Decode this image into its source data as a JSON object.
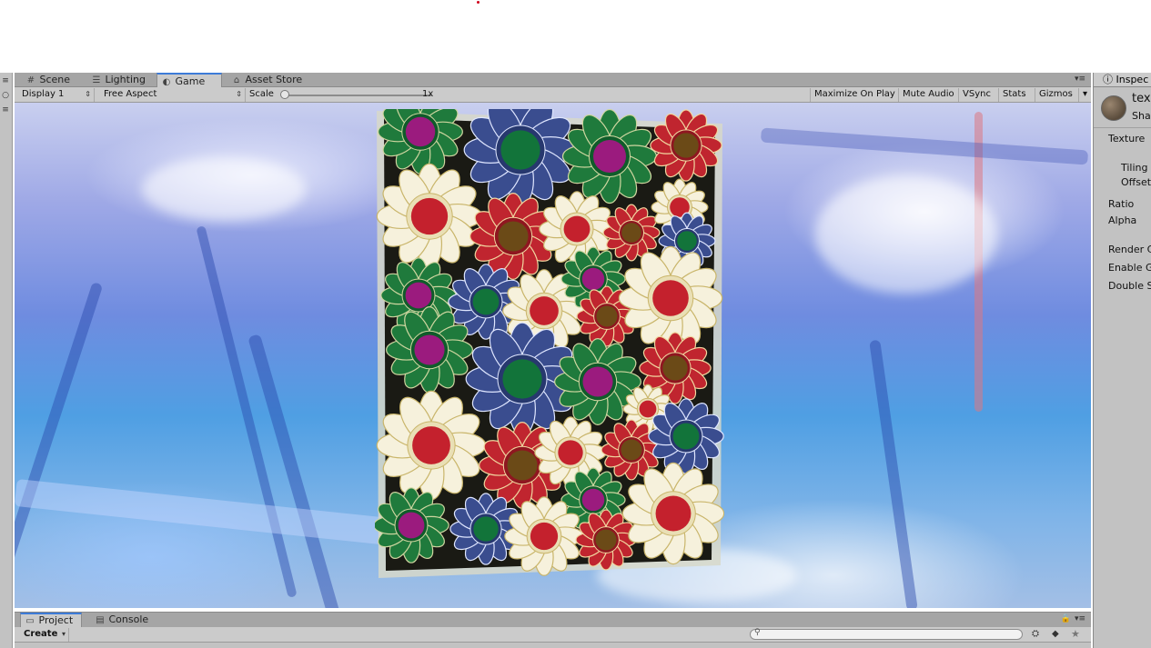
{
  "scene_tabs": [
    {
      "label": "Scene",
      "icon": "grid-icon"
    },
    {
      "label": "Lighting",
      "icon": "lighting-icon"
    },
    {
      "label": "Game",
      "icon": "game-icon"
    },
    {
      "label": "Asset Store",
      "icon": "store-icon"
    }
  ],
  "game_toolbar": {
    "display": "Display 1",
    "aspect": "Free Aspect",
    "scale_label": "Scale",
    "scale_value": "1x",
    "scale_level": 0,
    "maximize": "Maximize On Play",
    "mute": "Mute Audio",
    "vsync": "VSync",
    "stats": "Stats",
    "gizmos": "Gizmos"
  },
  "inspector": {
    "tab": "Inspec",
    "obj_name": "tex",
    "obj_shader": "Sha",
    "fields": [
      "Texture",
      "Tiling",
      "Offset",
      "Ratio",
      "Alpha",
      "Render C",
      "Enable G",
      "Double S"
    ]
  },
  "bottom": {
    "tabs": [
      "Project",
      "Console"
    ],
    "create": "Create"
  },
  "colors": {
    "accent": "#3d7bd8",
    "panel": "#c2c2c2"
  }
}
